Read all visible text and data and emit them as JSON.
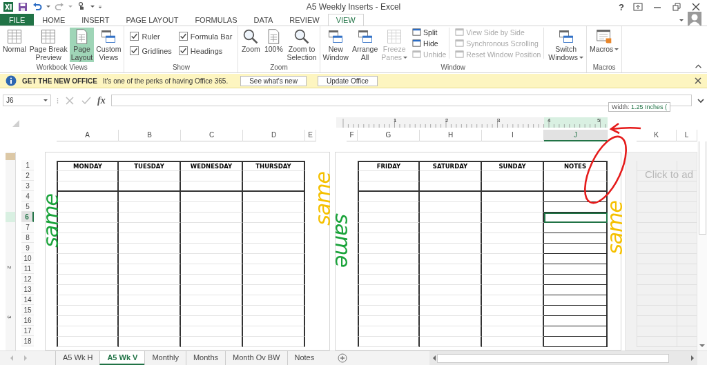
{
  "window": {
    "title": "A5 Weekly Inserts - Excel",
    "help": "?"
  },
  "ribbon_tabs": [
    {
      "label": "FILE",
      "kind": "file",
      "selected": false
    },
    {
      "label": "HOME",
      "kind": "tab",
      "selected": false
    },
    {
      "label": "INSERT",
      "kind": "tab",
      "selected": false
    },
    {
      "label": "PAGE LAYOUT",
      "kind": "tab",
      "selected": false
    },
    {
      "label": "FORMULAS",
      "kind": "tab",
      "selected": false
    },
    {
      "label": "DATA",
      "kind": "tab",
      "selected": false
    },
    {
      "label": "REVIEW",
      "kind": "tab",
      "selected": false
    },
    {
      "label": "VIEW",
      "kind": "tab",
      "selected": true
    }
  ],
  "ribbon_groups": [
    {
      "label": "Workbook Views",
      "items": [
        {
          "kind": "large",
          "label": "Normal",
          "selected": false
        },
        {
          "kind": "large",
          "label": "Page Break\nPreview",
          "selected": false
        },
        {
          "kind": "large",
          "label": "Page\nLayout",
          "selected": true
        },
        {
          "kind": "large",
          "label": "Custom\nViews",
          "selected": false
        }
      ]
    },
    {
      "label": "Show",
      "items": [
        {
          "kind": "check",
          "label": "Ruler",
          "checked": true
        },
        {
          "kind": "check",
          "label": "Formula Bar",
          "checked": true
        },
        {
          "kind": "check",
          "label": "Gridlines",
          "checked": true
        },
        {
          "kind": "check",
          "label": "Headings",
          "checked": true
        }
      ]
    },
    {
      "label": "Zoom",
      "items": [
        {
          "kind": "large",
          "label": "Zoom"
        },
        {
          "kind": "large",
          "label": "100%"
        },
        {
          "kind": "large",
          "label": "Zoom to\nSelection"
        }
      ]
    },
    {
      "label": "Window",
      "items": [
        {
          "kind": "large",
          "label": "New\nWindow",
          "disabled": false
        },
        {
          "kind": "large",
          "label": "Arrange\nAll",
          "disabled": false
        },
        {
          "kind": "large",
          "label": "Freeze\nPanes",
          "disabled": true,
          "dropdown": true
        },
        {
          "kind": "small",
          "label": "Split",
          "disabled": false
        },
        {
          "kind": "small",
          "label": "Hide",
          "disabled": false
        },
        {
          "kind": "small",
          "label": "Unhide",
          "disabled": true
        },
        {
          "kind": "small",
          "label": "View Side by Side",
          "disabled": true
        },
        {
          "kind": "small",
          "label": "Synchronous Scrolling",
          "disabled": true
        },
        {
          "kind": "small",
          "label": "Reset Window Position",
          "disabled": true
        },
        {
          "kind": "large",
          "label": "Switch\nWindows",
          "disabled": false,
          "dropdown": true
        }
      ]
    },
    {
      "label": "Macros",
      "items": [
        {
          "kind": "large",
          "label": "Macros",
          "dropdown": true
        }
      ]
    }
  ],
  "info_bar": {
    "title": "GET THE NEW OFFICE",
    "message": "It's one of the perks of having Office 365.",
    "buttons": [
      "See what's new",
      "Update Office"
    ]
  },
  "formula_bar": {
    "name_box": "J6",
    "function_label": "fx"
  },
  "tooltip": {
    "label": "Width:",
    "value": "1.25 Inches ("
  },
  "top_ruler": {
    "labels": [
      "1",
      "2",
      "3",
      "4",
      "5"
    ]
  },
  "side_ruler": {
    "labels": [
      "2",
      "3"
    ]
  },
  "columns": [
    {
      "label": "A",
      "selected": false
    },
    {
      "label": "B",
      "selected": false
    },
    {
      "label": "C",
      "selected": false
    },
    {
      "label": "D",
      "selected": false
    },
    {
      "label": "E",
      "selected": false
    },
    {
      "label": "F",
      "selected": false
    },
    {
      "label": "G",
      "selected": false
    },
    {
      "label": "H",
      "selected": false
    },
    {
      "label": "I",
      "selected": false
    },
    {
      "label": "J",
      "selected": true
    },
    {
      "label": "K",
      "selected": false
    },
    {
      "label": "L",
      "selected": false
    }
  ],
  "rows": [
    {
      "label": "1",
      "selected": false
    },
    {
      "label": "2",
      "selected": false
    },
    {
      "label": "3",
      "selected": false
    },
    {
      "label": "4",
      "selected": false
    },
    {
      "label": "5",
      "selected": false
    },
    {
      "label": "6",
      "selected": true
    },
    {
      "label": "7",
      "selected": false
    },
    {
      "label": "8",
      "selected": false
    },
    {
      "label": "9",
      "selected": false
    },
    {
      "label": "10",
      "selected": false
    },
    {
      "label": "11",
      "selected": false
    },
    {
      "label": "12",
      "selected": false
    },
    {
      "label": "13",
      "selected": false
    },
    {
      "label": "14",
      "selected": false
    },
    {
      "label": "15",
      "selected": false
    },
    {
      "label": "16",
      "selected": false
    },
    {
      "label": "17",
      "selected": false
    },
    {
      "label": "18",
      "selected": false
    }
  ],
  "pages": [
    {
      "headers": [
        {
          "label": "MONDAY",
          "kind": "day"
        },
        {
          "label": "TUESDAY",
          "kind": "day"
        },
        {
          "label": "WEDNESDAY",
          "kind": "day"
        },
        {
          "label": "THURSDAY",
          "kind": "day"
        }
      ]
    },
    {
      "headers": [
        {
          "label": "FRIDAY",
          "kind": "day"
        },
        {
          "label": "SATURDAY",
          "kind": "day"
        },
        {
          "label": "SUNDAY",
          "kind": "day"
        },
        {
          "label": "NOTES",
          "kind": "notes"
        }
      ]
    },
    {
      "placeholder": "Click to ad"
    }
  ],
  "annotations": [
    {
      "text": "same",
      "color": "#1aa33a"
    },
    {
      "text": "same",
      "color": "#f5c000"
    },
    {
      "text": "same",
      "color": "#1aa33a"
    },
    {
      "text": "same",
      "color": "#f5c000"
    }
  ],
  "sheet_tabs": [
    {
      "label": "A5 Wk H",
      "selected": false
    },
    {
      "label": "A5 Wk V",
      "selected": true
    },
    {
      "label": "Monthly",
      "selected": false
    },
    {
      "label": "Months",
      "selected": false
    },
    {
      "label": "Month Ov BW",
      "selected": false
    },
    {
      "label": "Notes",
      "selected": false
    }
  ]
}
